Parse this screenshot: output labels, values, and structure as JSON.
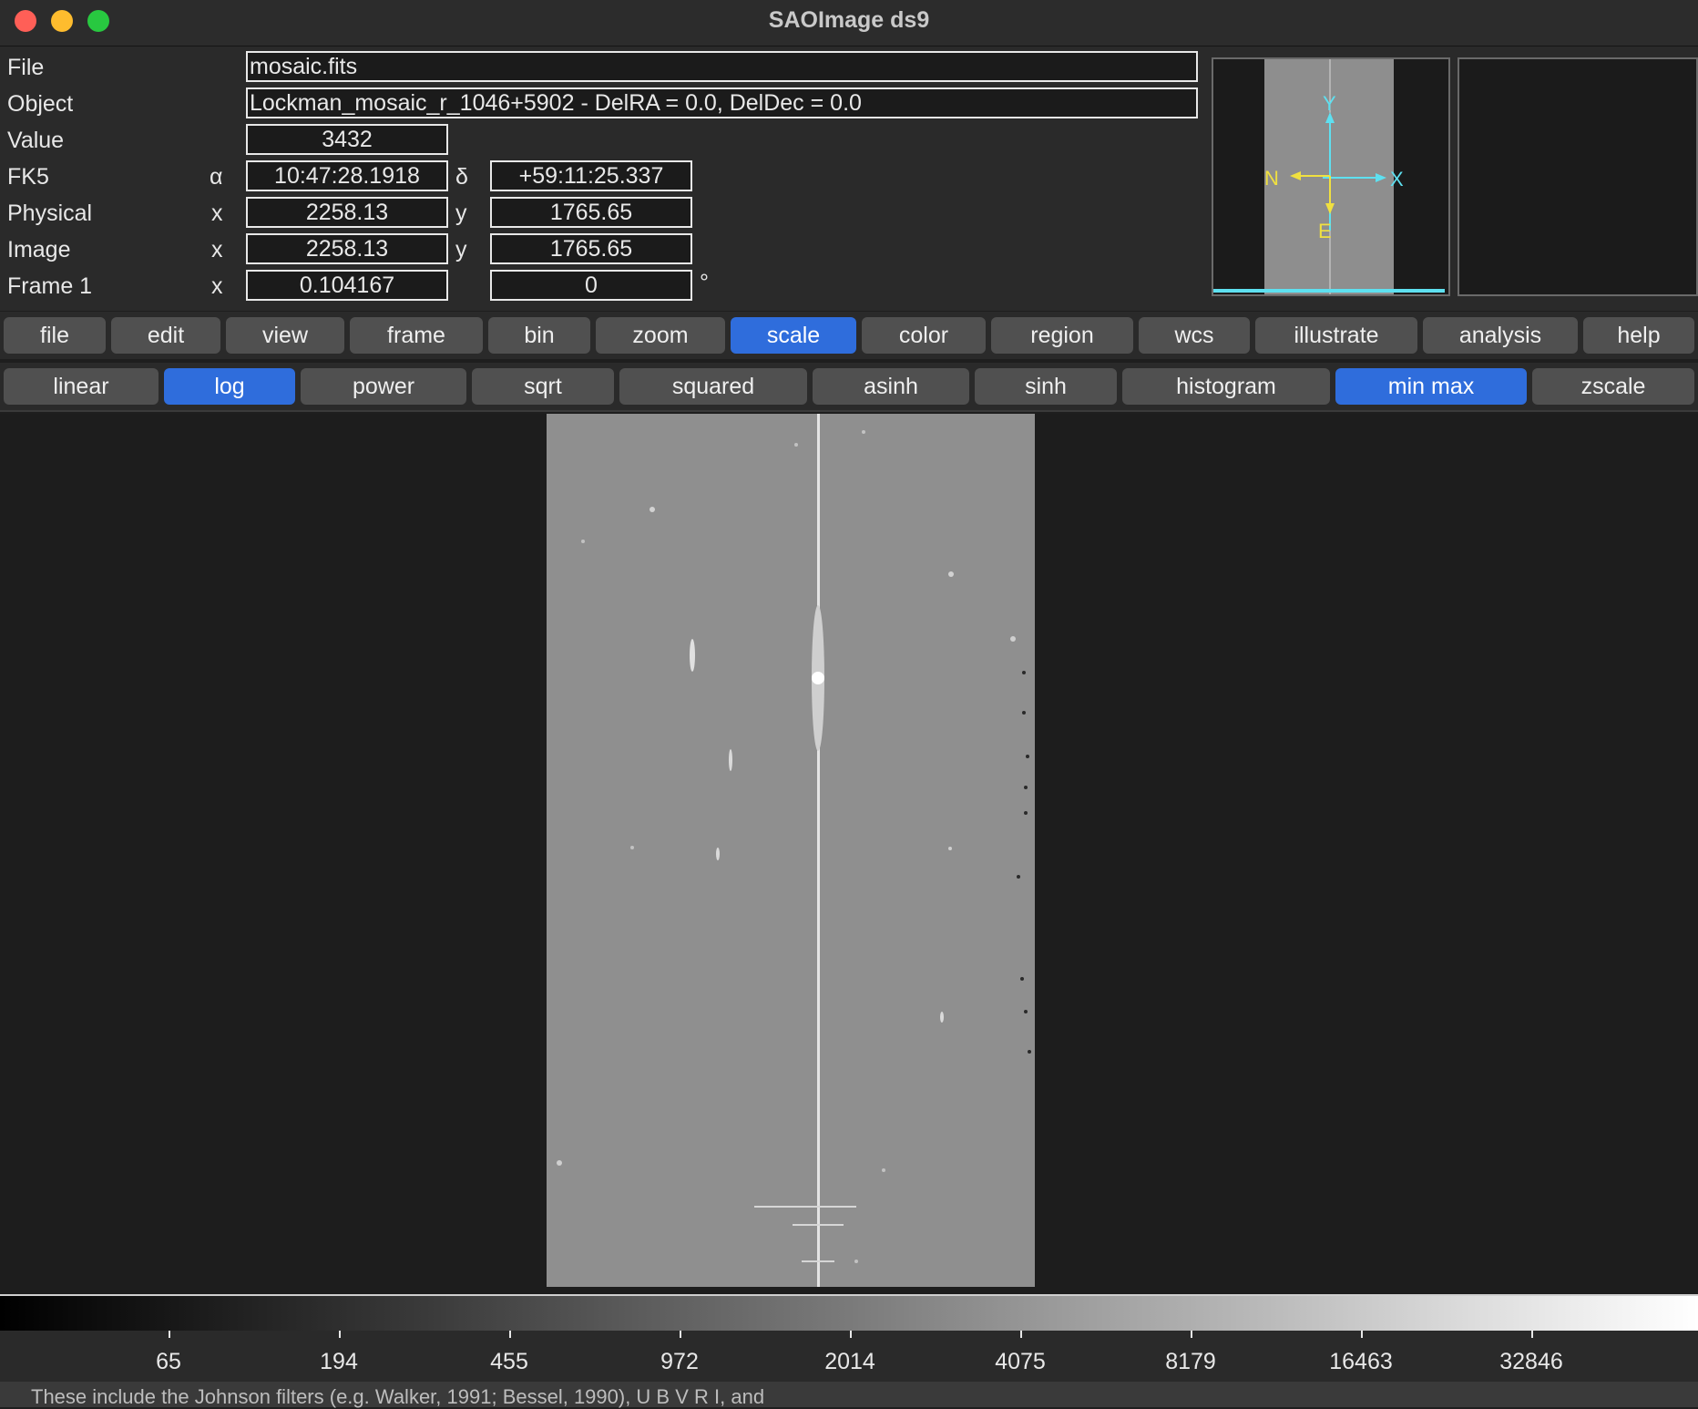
{
  "window": {
    "title": "SAOImage ds9"
  },
  "info": {
    "file_label": "File",
    "file_value": "mosaic.fits",
    "object_label": "Object",
    "object_value": "Lockman_mosaic_r_1046+5902 - DelRA =   0.0, DelDec =   0.0",
    "value_label": "Value",
    "value_value": "3432",
    "fk5_label": "FK5",
    "fk5_alpha_sym": "α",
    "fk5_alpha": "10:47:28.1918",
    "fk5_delta_sym": "δ",
    "fk5_delta": "+59:11:25.337",
    "physical_label": "Physical",
    "physical_x_sym": "x",
    "physical_x": "2258.13",
    "physical_y_sym": "y",
    "physical_y": "1765.65",
    "image_label": "Image",
    "image_x_sym": "x",
    "image_x": "2258.13",
    "image_y_sym": "y",
    "image_y": "1765.65",
    "frame_label": "Frame 1",
    "frame_x_sym": "x",
    "frame_zoom": "0.104167",
    "frame_angle": "0",
    "frame_degree": "°"
  },
  "panner": {
    "compass_y": "Y",
    "compass_x": "X",
    "compass_n": "N",
    "compass_e": "E"
  },
  "menu": {
    "items": [
      "file",
      "edit",
      "view",
      "frame",
      "bin",
      "zoom",
      "scale",
      "color",
      "region",
      "wcs",
      "illustrate",
      "analysis",
      "help"
    ],
    "active": "scale"
  },
  "scale_buttons": {
    "items": [
      "linear",
      "log",
      "power",
      "sqrt",
      "squared",
      "asinh",
      "sinh",
      "histogram",
      "min max",
      "zscale"
    ],
    "active": [
      "log",
      "min max"
    ]
  },
  "colorbar": {
    "ticks": [
      "65",
      "194",
      "455",
      "972",
      "2014",
      "4075",
      "8179",
      "16463",
      "32846"
    ]
  },
  "bottom_overlap_text": "These include the Johnson filters (e.g. Walker, 1991; Bessel, 1990), U B V R I, and"
}
